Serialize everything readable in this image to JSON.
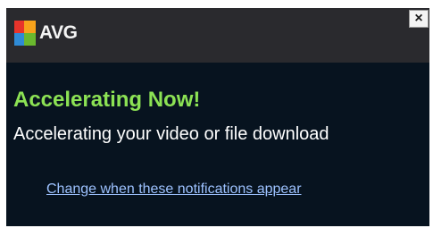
{
  "header": {
    "brand": "AVG",
    "logo_icon": "avg-logo-icon",
    "close_label": "×"
  },
  "notification": {
    "title": "Accelerating Now!",
    "message": "Accelerating your video or file download",
    "link": "Change when these notifications appear"
  },
  "colors": {
    "background": "#07131f",
    "header": "#2a2a2e",
    "title": "#8ce254",
    "link": "#9dc2ff"
  }
}
